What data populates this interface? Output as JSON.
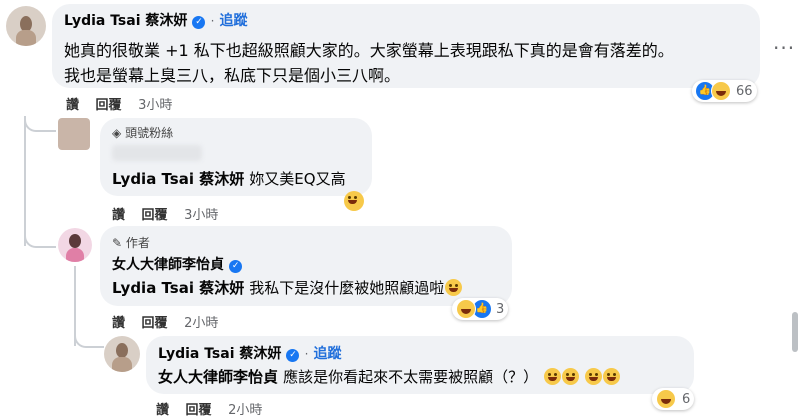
{
  "comment1": {
    "author": "Lydia Tsai 蔡沐妍",
    "follow": "追蹤",
    "line1": "她真的很敬業 +1 私下也超級照顧大家的。大家螢幕上表現跟私下真的是會有落差的。",
    "line2": "我也是螢幕上臭三八，私底下只是個小三八啊。",
    "actions": {
      "like": "讚",
      "reply": "回覆",
      "time": "3小時"
    },
    "reactions": {
      "count": "66"
    }
  },
  "comment2": {
    "badge": "頭號粉絲",
    "mention": "Lydia Tsai 蔡沐妍",
    "text": "妳又美EQ又高",
    "actions": {
      "like": "讚",
      "reply": "回覆",
      "time": "3小時"
    }
  },
  "comment3": {
    "badge": "作者",
    "author": "女人大律師李怡貞",
    "mention": "Lydia Tsai 蔡沐妍",
    "text": "我私下是沒什麼被她照顧過啦",
    "actions": {
      "like": "讚",
      "reply": "回覆",
      "time": "2小時"
    },
    "reactions": {
      "count": "3"
    }
  },
  "comment4": {
    "author": "Lydia Tsai 蔡沐妍",
    "follow": "追蹤",
    "mention": "女人大律師李怡貞",
    "text": "應該是你看起來不太需要被照顧（？）",
    "actions": {
      "like": "讚",
      "reply": "回覆",
      "time": "2小時"
    },
    "reactions": {
      "count": "6"
    }
  },
  "more_icon": "more-options-icon"
}
